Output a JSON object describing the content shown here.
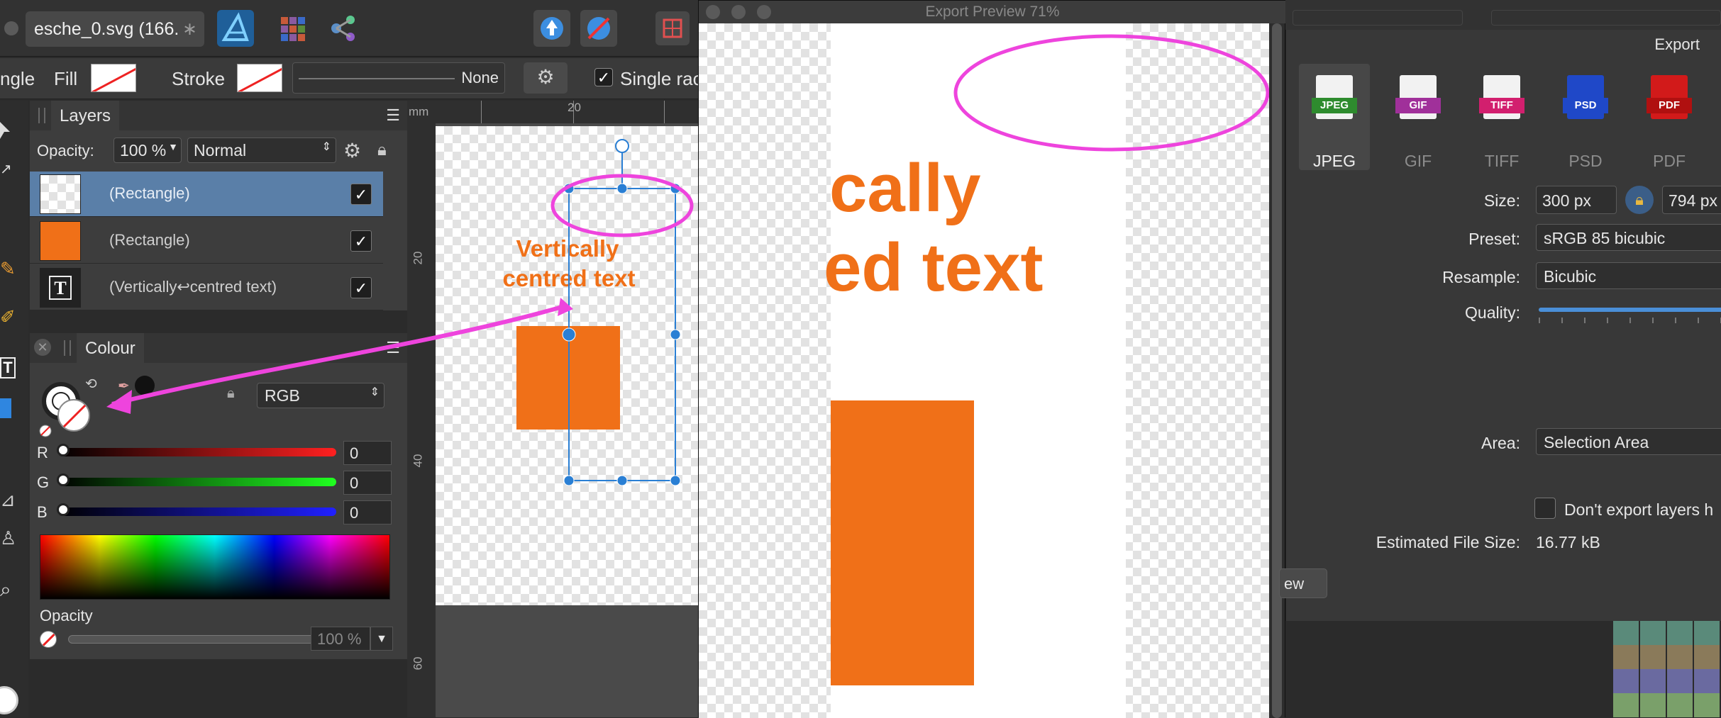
{
  "app": {
    "doc_tab": "esche_0.svg (166.",
    "doc_tab_close": "∗"
  },
  "context": {
    "partial_label": "ngle",
    "fill_label": "Fill",
    "stroke_label": "Stroke",
    "stroke_style": "None",
    "single_radius_label": "Single rac"
  },
  "layers": {
    "title": "Layers",
    "opacity_label": "Opacity:",
    "opacity_value": "100 %",
    "blend_mode": "Normal",
    "items": [
      {
        "name": "(Rectangle)"
      },
      {
        "name": "(Rectangle)"
      },
      {
        "name": "(Vertically↩centred text)"
      }
    ]
  },
  "colour": {
    "title": "Colour",
    "mode": "RGB",
    "r_label": "R",
    "r_value": "0",
    "g_label": "G",
    "g_value": "0",
    "b_label": "B",
    "b_value": "0",
    "opacity_label": "Opacity",
    "opacity_value": "100 %"
  },
  "canvas": {
    "ruler_unit": "mm",
    "ruler_top_20": "20",
    "ruler_left_20": "20",
    "ruler_left_40": "40",
    "ruler_left_60": "60",
    "text_line1": "Vertically",
    "text_line2": "centred text"
  },
  "preview": {
    "title": "Export Preview 71%",
    "text_line1": "cally",
    "text_line2": "ed text"
  },
  "export": {
    "title": "Export",
    "formats": [
      {
        "label": "JPEG",
        "icon_text": "JPEG",
        "color": "#2e8b2e"
      },
      {
        "label": "GIF",
        "icon_text": "GIF",
        "color": "#a0309a"
      },
      {
        "label": "TIFF",
        "icon_text": "TIFF",
        "color": "#d21f6e"
      },
      {
        "label": "PSD",
        "icon_text": "PSD",
        "color": "#1f48c8"
      },
      {
        "label": "PDF",
        "icon_text": "PDF",
        "color": "#d21a1a"
      }
    ],
    "size_label": "Size:",
    "width_value": "300 px",
    "height_value": "794 px",
    "preset_label": "Preset:",
    "preset_value": "sRGB 85 bicubic",
    "resample_label": "Resample:",
    "resample_value": "Bicubic",
    "quality_label": "Quality:",
    "area_label": "Area:",
    "area_value": "Selection Area",
    "dont_export_label": "Don't export layers h",
    "file_size_label": "Estimated File Size:",
    "file_size_value": "16.77 kB",
    "preview_button": "ew"
  },
  "colors": {
    "orange": "#f07018",
    "annotation_magenta": "#ee44dd",
    "selection_blue": "#2a7fd4",
    "selected_layer": "#5a7fa8"
  }
}
